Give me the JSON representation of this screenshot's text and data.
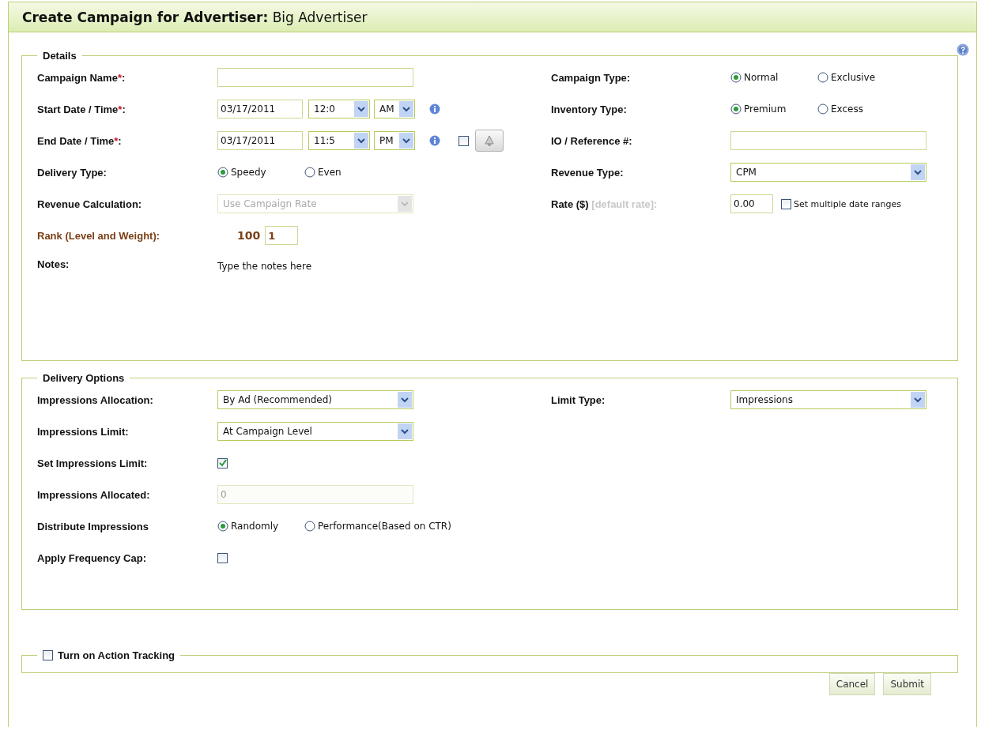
{
  "title": "**Create Campaign for Advertiser:** Big Advertiser",
  "sections": [
    {
      "legend": "Details",
      "columns": [
        [
          {
            "kind": "text",
            "label": "Campaign Name",
            "required_mark": "*",
            "label_end": ":",
            "disabled": false
          },
          {
            "kind": "datetime",
            "label": "Start Date / Time",
            "required_mark": "*",
            "label_end": ":",
            "date": "03/17/2011",
            "time": "12:0",
            "meridiem": "AM"
          },
          {
            "kind": "datetime",
            "label": "End Date / Time",
            "required_mark": "*",
            "label_end": ":",
            "date": "03/17/2011",
            "time": "11:5",
            "meridiem": "PM",
            "toggle": {
              "checked": false
            }
          },
          {
            "kind": "radio",
            "label": "Delivery Type:",
            "options": [
              {
                "label": "Speedy",
                "selected": true
              },
              {
                "label": "Even",
                "selected": false
              }
            ]
          },
          {
            "kind": "select",
            "label": "Revenue Calculation:",
            "value": "Use Campaign Rate",
            "disabled": true
          },
          {
            "kind": "rank",
            "label": "Rank (Level and Weight):",
            "highlighted": true,
            "base": "100",
            "value": "1"
          },
          {
            "kind": "note",
            "label": "Notes:",
            "value": "Type the notes here"
          }
        ],
        [
          {
            "kind": "radio",
            "label": "Campaign Type:",
            "options": [
              {
                "label": "Normal",
                "selected": true
              },
              {
                "label": "Exclusive",
                "selected": false
              }
            ]
          },
          {
            "kind": "radio",
            "label": "Inventory Type:",
            "options": [
              {
                "label": "Premium",
                "selected": true
              },
              {
                "label": "Excess",
                "selected": false
              }
            ]
          },
          {
            "kind": "text",
            "label": "IO / Reference #:",
            "disabled": false
          },
          {
            "kind": "select",
            "label": "Revenue Type:",
            "value": "CPM",
            "disabled": false
          },
          {
            "kind": "rate",
            "label": "Rate ($)",
            "hint": "[default rate]:",
            "value": "0.00",
            "option": {
              "label": "Set multiple date ranges",
              "checked": false
            }
          }
        ]
      ]
    },
    {
      "legend": "Delivery Options",
      "columns": [
        [
          {
            "kind": "select",
            "label": "Impressions Allocation:",
            "value": "By Ad (Recommended)",
            "disabled": false
          },
          {
            "kind": "select",
            "label": "Impressions Limit:",
            "value": "At Campaign Level",
            "disabled": false
          },
          {
            "kind": "checkbox",
            "label": "Set Impressions Limit:",
            "checked": true
          },
          {
            "kind": "text",
            "label": "Impressions Allocated:",
            "placeholder": "0",
            "disabled": true
          },
          {
            "kind": "radio",
            "label": "Distribute Impressions",
            "options": [
              {
                "label": "Randomly",
                "selected": true
              },
              {
                "label": "Performance(Based on CTR)",
                "selected": false
              }
            ]
          },
          {
            "kind": "checkbox",
            "label": "Apply Frequency Cap:",
            "checked": false
          }
        ],
        [
          {
            "kind": "select",
            "label": "Limit Type:",
            "value": "Impressions",
            "disabled": false
          }
        ]
      ]
    }
  ],
  "action_tracking": {
    "label": "Turn on Action Tracking",
    "checked": false
  },
  "buttons": [
    {
      "label": "Cancel"
    },
    {
      "label": "Submit"
    }
  ]
}
